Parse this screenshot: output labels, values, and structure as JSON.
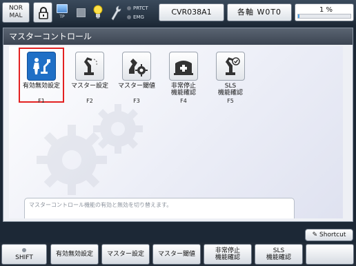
{
  "topbar": {
    "mode": "NOR\nMAL",
    "tp_label": "TP",
    "prtct_label": "PRTCT",
    "emg_label": "EMG",
    "robot": "CVR038A1",
    "axis": "各軸 W0T0",
    "speed": "1 %",
    "speed_level": 0.01
  },
  "window": {
    "title": "マスターコントロール",
    "functions": [
      {
        "name": "有効無効設定",
        "key": "F1",
        "icon": "person-robot-icon",
        "selected": true
      },
      {
        "name": "マスター設定",
        "key": "F2",
        "icon": "robot-arm-icon",
        "selected": false
      },
      {
        "name": "マスター閾値",
        "key": "F3",
        "icon": "robot-gear-icon",
        "selected": false
      },
      {
        "name": "非常停止\n機能確認",
        "key": "F4",
        "icon": "ambulance-icon",
        "selected": false
      },
      {
        "name": "SLS\n機能確認",
        "key": "F5",
        "icon": "robot-check-icon",
        "selected": false
      }
    ],
    "description": "マスターコントロール機能の有効と無効を切り替えます。"
  },
  "shortcut": "Shortcut",
  "fkeys": [
    {
      "label": "SHIFT"
    },
    {
      "label": "有効無効設定"
    },
    {
      "label": "マスター設定"
    },
    {
      "label": "マスター閾値"
    },
    {
      "label": "非常停止\n機能確認"
    },
    {
      "label": "SLS\n機能確認"
    },
    {
      "label": ""
    }
  ]
}
